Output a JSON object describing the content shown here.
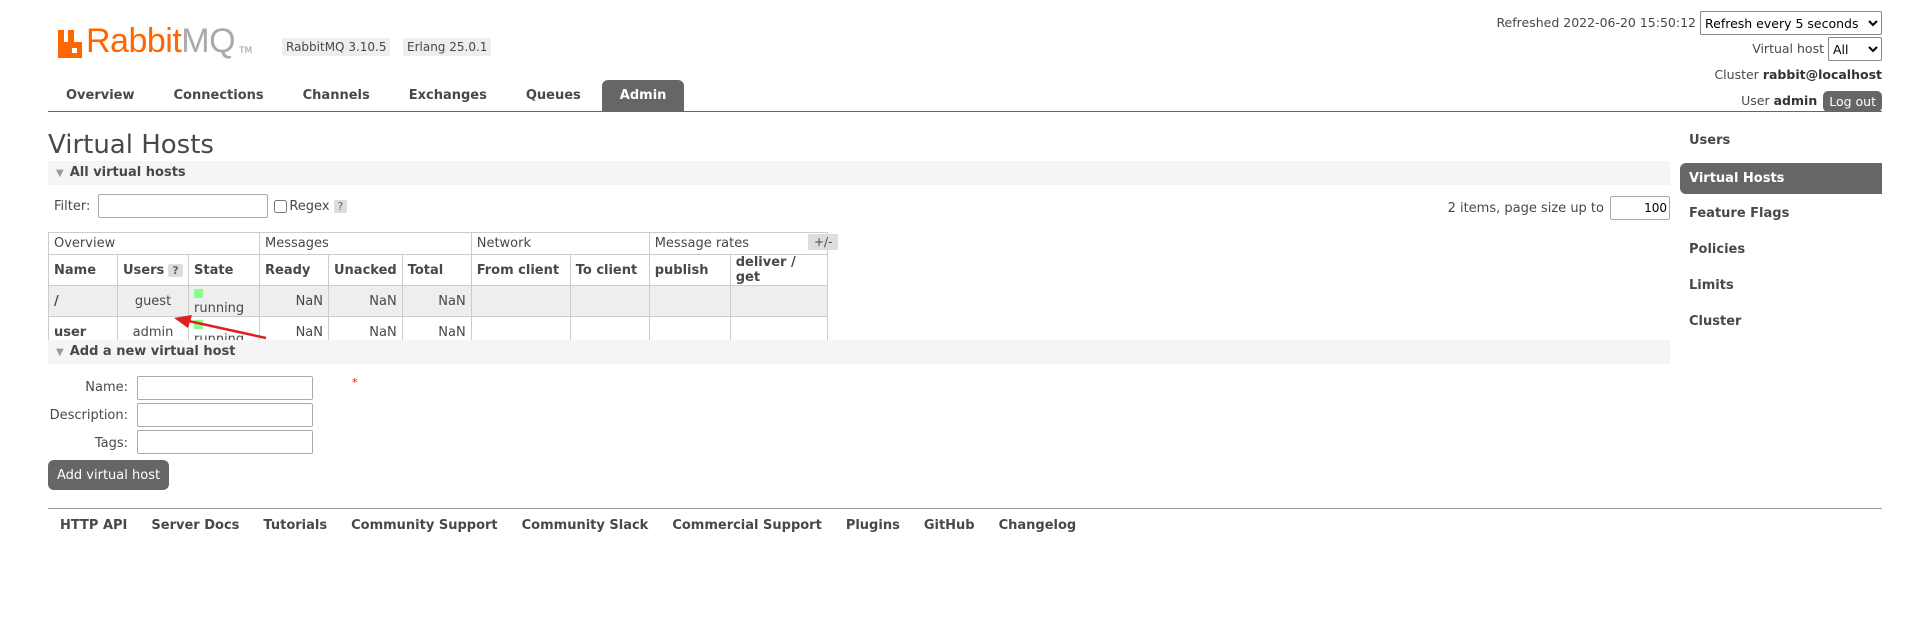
{
  "header": {
    "brand_rabbit": "Rabbit",
    "brand_mq": "MQ",
    "brand_tm": "TM",
    "version_label": "RabbitMQ 3.10.5",
    "erlang_label": "Erlang 25.0.1"
  },
  "status": {
    "refreshed_label": "Refreshed 2022-06-20 15:50:12",
    "refresh_select": "Refresh every 5 seconds",
    "vhost_label": "Virtual host",
    "vhost_select": "All",
    "cluster_label": "Cluster",
    "cluster_value": "rabbit@localhost",
    "user_label": "User",
    "user_value": "admin",
    "logout_label": "Log out"
  },
  "tabs": [
    "Overview",
    "Connections",
    "Channels",
    "Exchanges",
    "Queues",
    "Admin"
  ],
  "sidebar": [
    "Users",
    "Virtual Hosts",
    "Feature Flags",
    "Policies",
    "Limits",
    "Cluster"
  ],
  "page_title": "Virtual Hosts",
  "all_vhosts": {
    "section_title": "All virtual hosts",
    "filter_label": "Filter:",
    "regex_label": "Regex",
    "help_mark": "?",
    "page_info": "2 items, page size up to",
    "page_size": "100",
    "plusminus": "+/-",
    "groups": [
      "Overview",
      "Messages",
      "Network",
      "Message rates"
    ],
    "columns": [
      "Name",
      "Users",
      "State",
      "Ready",
      "Unacked",
      "Total",
      "From client",
      "To client",
      "publish",
      "deliver / get"
    ],
    "rows": [
      {
        "name": "/",
        "users": "guest",
        "state": "running",
        "ready": "NaN",
        "unacked": "NaN",
        "total": "NaN"
      },
      {
        "name": "user",
        "users": "admin",
        "state": "running",
        "ready": "NaN",
        "unacked": "NaN",
        "total": "NaN"
      }
    ]
  },
  "add_vhost": {
    "section_title": "Add a new virtual host",
    "name_label": "Name:",
    "description_label": "Description:",
    "tags_label": "Tags:",
    "required_mark": "*",
    "button": "Add virtual host"
  },
  "footer": [
    "HTTP API",
    "Server Docs",
    "Tutorials",
    "Community Support",
    "Community Slack",
    "Commercial Support",
    "Plugins",
    "GitHub",
    "Changelog"
  ],
  "colors": {
    "brand_orange": "#ff6600",
    "tab_active": "#666666",
    "annotation_arrow": "#e02020"
  }
}
